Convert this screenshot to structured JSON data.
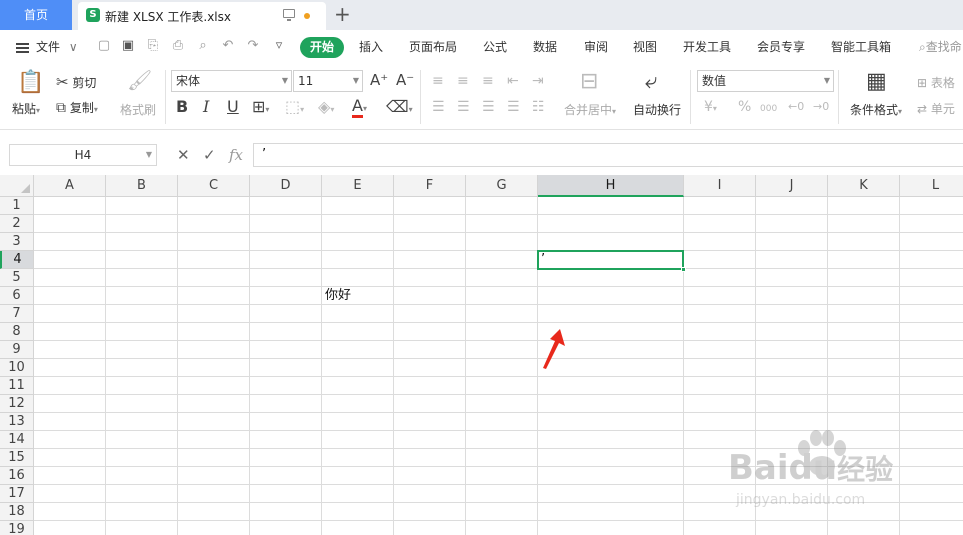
{
  "tabs": {
    "home_label": "首页",
    "file_label": "新建 XLSX 工作表.xlsx",
    "file_icon_letter": "S",
    "new_tab_symbol": "+"
  },
  "menu": {
    "file_label": "文件",
    "file_chevron": "∨",
    "items": [
      "开始",
      "插入",
      "页面布局",
      "公式",
      "数据",
      "审阅",
      "视图",
      "开发工具",
      "会员专享",
      "智能工具箱"
    ],
    "search_label": "查找命"
  },
  "ribbon": {
    "paste_label": "粘贴",
    "cut_label": "剪切",
    "copy_label": "复制",
    "format_painter_label": "格式刷",
    "font_name": "宋体",
    "font_size": "11",
    "bold": "B",
    "italic": "I",
    "underline": "U",
    "font_color_letter": "A",
    "grow_font": "A⁺",
    "shrink_font": "A⁻",
    "merge_label": "合并居中",
    "wrap_label": "自动换行",
    "number_format": "数值",
    "currency_symbol": "¥",
    "percent_symbol": "%",
    "thousands_symbol": "000",
    "conditional_format_label": "条件格式",
    "table_style_label": "表格",
    "cell_label": "单元"
  },
  "formula_bar": {
    "name_box": "H4",
    "cancel_symbol": "✕",
    "confirm_symbol": "✓",
    "fx_symbol": "fx",
    "value": "’"
  },
  "grid": {
    "columns": [
      "A",
      "B",
      "C",
      "D",
      "E",
      "F",
      "G",
      "H",
      "I",
      "J",
      "K",
      "L"
    ],
    "rows": [
      "1",
      "2",
      "3",
      "4",
      "5",
      "6",
      "7",
      "8",
      "9",
      "10",
      "11",
      "12",
      "13",
      "14",
      "15",
      "16",
      "17",
      "18",
      "19"
    ],
    "active_column": "H",
    "active_row": "4",
    "cells": {
      "E6": "你好",
      "H4": "’"
    }
  },
  "colors": {
    "accent_green": "#1fa35c",
    "home_blue": "#4f8ef7",
    "arrow_red": "#e8291c"
  },
  "watermark": {
    "brand": "Baidu",
    "suffix": "经验",
    "url": "jingyan.baidu.com"
  }
}
